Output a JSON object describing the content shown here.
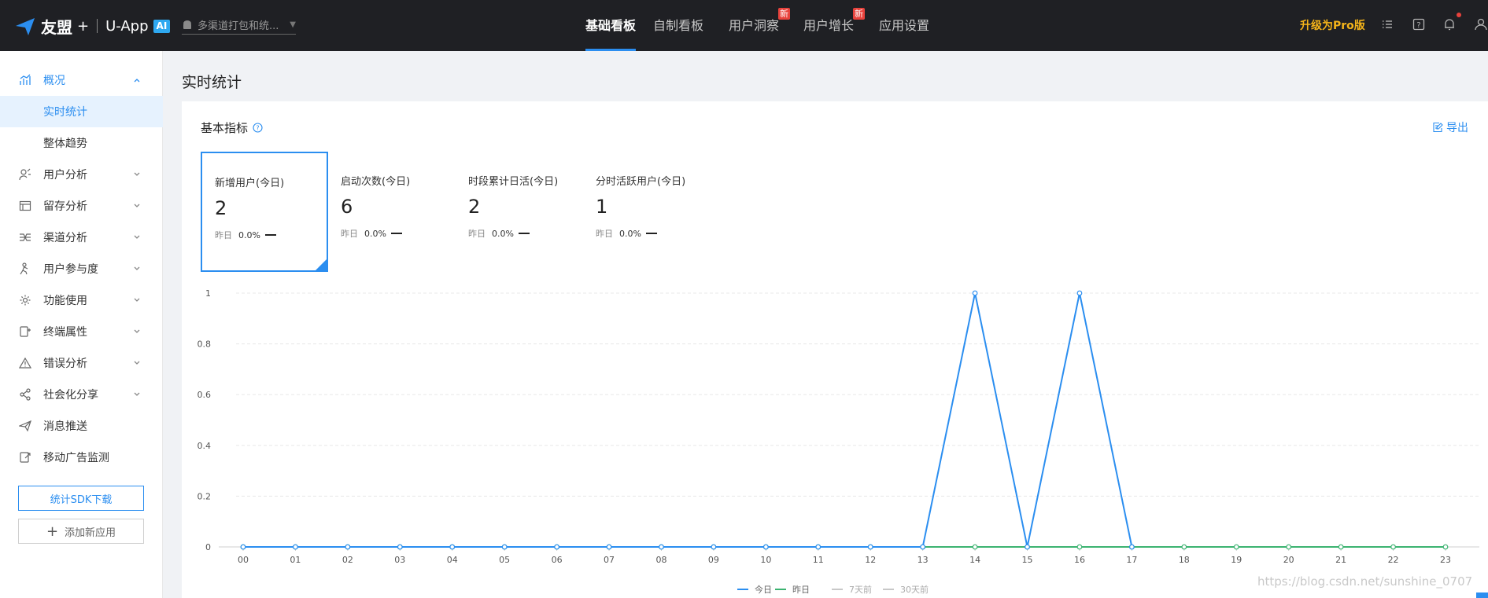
{
  "header": {
    "brand": "友盟",
    "plus": "+",
    "product": "U-App",
    "ai_badge": "AI",
    "channel_placeholder": "多渠道打包和统...",
    "nav": [
      {
        "label": "基础看板",
        "active": true,
        "badge": ""
      },
      {
        "label": "自制看板",
        "active": false,
        "badge": ""
      },
      {
        "label": "用户洞察",
        "active": false,
        "badge": "新"
      },
      {
        "label": "用户增长",
        "active": false,
        "badge": "新"
      },
      {
        "label": "应用设置",
        "active": false,
        "badge": ""
      }
    ],
    "upgrade": "升级为Pro版",
    "icons": [
      "list-icon",
      "help-icon",
      "bell-icon",
      "user-icon"
    ]
  },
  "sidebar": {
    "items": [
      {
        "label": "概况",
        "icon": "overview-chart-icon",
        "open": true
      },
      {
        "label": "实时统计",
        "sub": true,
        "active": true
      },
      {
        "label": "整体趋势",
        "sub": true,
        "active": false
      },
      {
        "label": "用户分析",
        "icon": "user-analysis-icon"
      },
      {
        "label": "留存分析",
        "icon": "retention-icon"
      },
      {
        "label": "渠道分析",
        "icon": "channel-icon"
      },
      {
        "label": "用户参与度",
        "icon": "engagement-icon"
      },
      {
        "label": "功能使用",
        "icon": "gear-icon"
      },
      {
        "label": "终端属性",
        "icon": "device-icon"
      },
      {
        "label": "错误分析",
        "icon": "warning-icon"
      },
      {
        "label": "社会化分享",
        "icon": "share-icon"
      },
      {
        "label": "消息推送",
        "icon": "send-icon",
        "no_chevron": true
      },
      {
        "label": "移动广告监测",
        "icon": "ad-monitor-icon",
        "no_chevron": true
      }
    ],
    "sdk_button": "统计SDK下载",
    "add_button": "添加新应用"
  },
  "main": {
    "page_title": "实时统计",
    "card_title": "基本指标",
    "export_label": "导出",
    "metrics": [
      {
        "label": "新增用户(今日)",
        "value": "2",
        "cmp_label": "昨日",
        "cmp_pct": "0.0%",
        "selected": true
      },
      {
        "label": "启动次数(今日)",
        "value": "6",
        "cmp_label": "昨日",
        "cmp_pct": "0.0%",
        "selected": false
      },
      {
        "label": "时段累计日活(今日)",
        "value": "2",
        "cmp_label": "昨日",
        "cmp_pct": "0.0%",
        "selected": false
      },
      {
        "label": "分时活跃用户(今日)",
        "value": "1",
        "cmp_label": "昨日",
        "cmp_pct": "0.0%",
        "selected": false
      }
    ]
  },
  "chart_data": {
    "type": "line",
    "x": [
      "00",
      "01",
      "02",
      "03",
      "04",
      "05",
      "06",
      "07",
      "08",
      "09",
      "10",
      "11",
      "12",
      "13",
      "14",
      "15",
      "16",
      "17",
      "18",
      "19",
      "20",
      "21",
      "22",
      "23"
    ],
    "yticks": [
      "0",
      "0.2",
      "0.4",
      "0.6",
      "0.8",
      "1"
    ],
    "ylim": [
      0,
      1
    ],
    "grid": true,
    "legend_position": "bottom",
    "series": [
      {
        "name": "今日",
        "color": "#2b8ef0",
        "values": [
          0,
          0,
          0,
          0,
          0,
          0,
          0,
          0,
          0,
          0,
          0,
          0,
          0,
          0,
          1,
          0,
          1,
          0,
          null,
          null,
          null,
          null,
          null,
          null
        ]
      },
      {
        "name": "昨日",
        "color": "#3cb371",
        "values": [
          0,
          0,
          0,
          0,
          0,
          0,
          0,
          0,
          0,
          0,
          0,
          0,
          0,
          0,
          0,
          0,
          0,
          0,
          0,
          0,
          0,
          0,
          0,
          0
        ]
      },
      {
        "name": "7天前",
        "color": "#c8c8c8",
        "values": []
      },
      {
        "name": "30天前",
        "color": "#c8c8c8",
        "values": []
      }
    ]
  },
  "watermark": "https://blog.csdn.net/sunshine_0707"
}
